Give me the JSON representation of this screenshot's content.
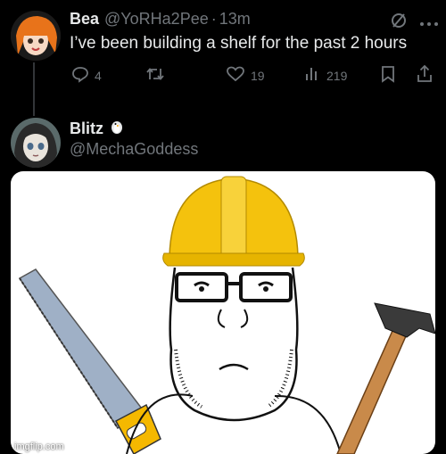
{
  "tweet": {
    "display_name": "Bea",
    "handle": "@YoRHa2Pee",
    "separator": "·",
    "time": "13m",
    "text": "I’ve been building a shelf for the past 2 hours",
    "actions": {
      "replies": "4",
      "retweets": "",
      "likes": "19",
      "views": "219"
    }
  },
  "reply": {
    "display_name": "Blitz",
    "handle": "@MechaGoddess"
  },
  "media": {
    "description_icons": [
      "saw-icon",
      "hard-hat-icon",
      "glasses-icon",
      "hammer-icon"
    ]
  },
  "watermark": "imgflip.com",
  "colors": {
    "background": "#000000",
    "text": "#e7e9ea",
    "muted": "#71767b",
    "hat": "#f4c20d",
    "saw_handle": "#f5b800"
  }
}
